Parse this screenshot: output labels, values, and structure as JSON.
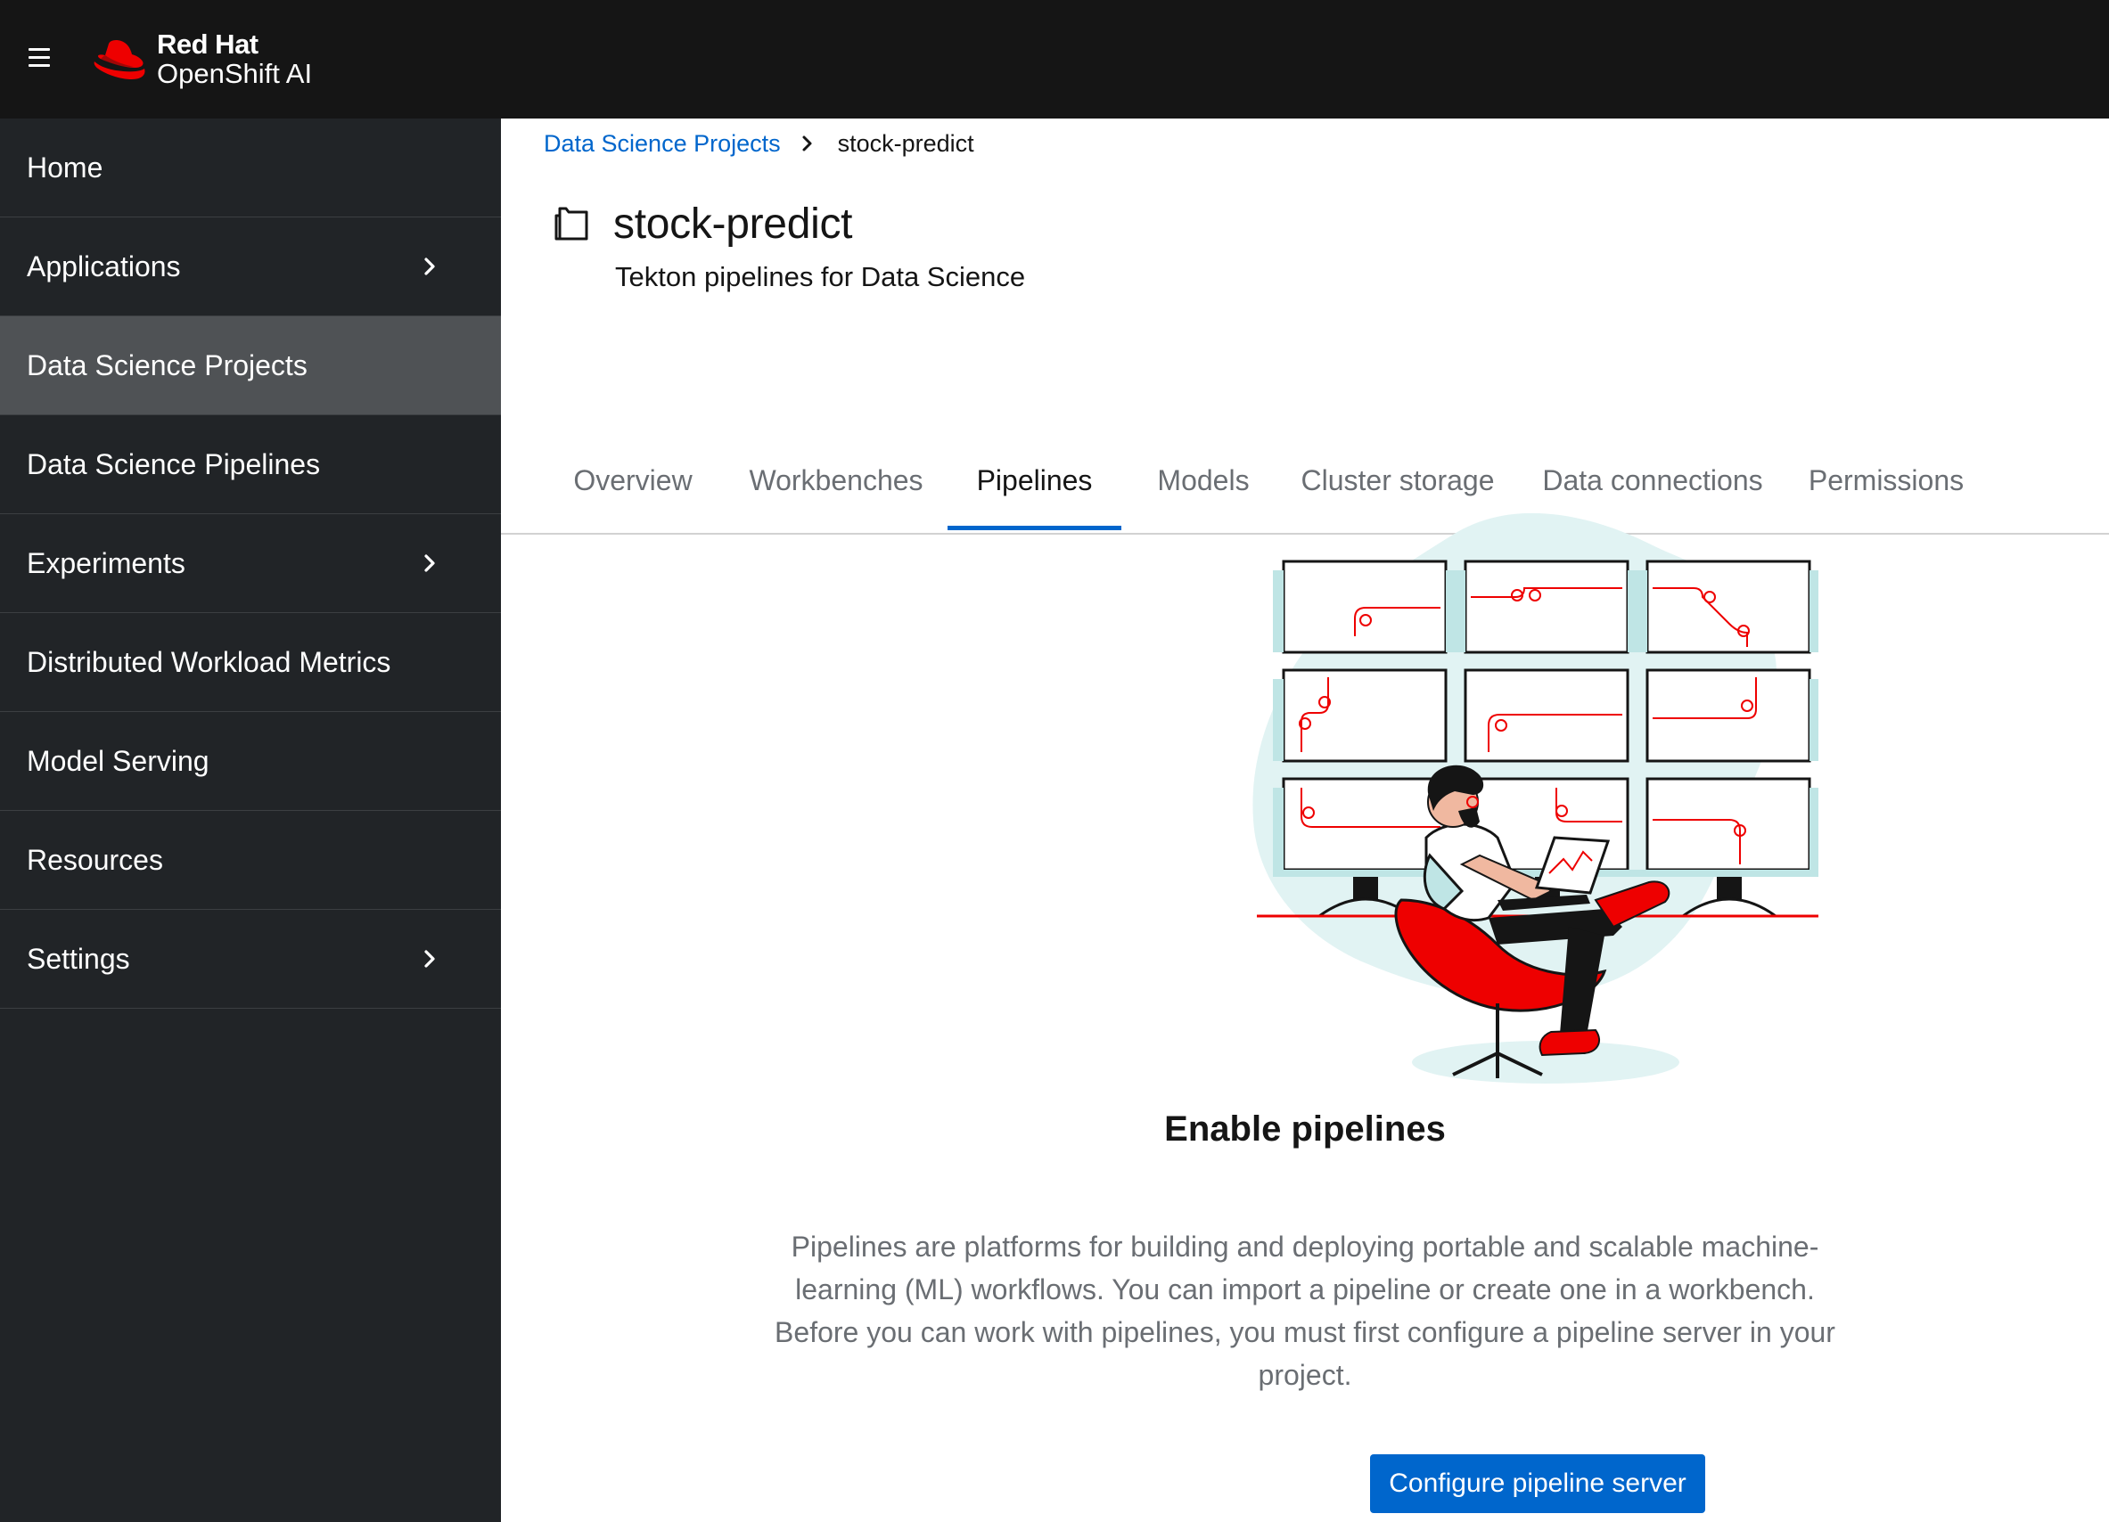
{
  "masthead": {
    "brand_line1": "Red Hat",
    "brand_line2": "OpenShift AI",
    "menu_icon": "hamburger-icon",
    "brand_color": "#ee0000"
  },
  "sidebar": {
    "items": [
      {
        "label": "Home",
        "has_submenu": false
      },
      {
        "label": "Applications",
        "has_submenu": true
      },
      {
        "label": "Data Science Projects",
        "has_submenu": false,
        "active": true
      },
      {
        "label": "Data Science Pipelines",
        "has_submenu": false
      },
      {
        "label": "Experiments",
        "has_submenu": true
      },
      {
        "label": "Distributed Workload Metrics",
        "has_submenu": false
      },
      {
        "label": "Model Serving",
        "has_submenu": false
      },
      {
        "label": "Resources",
        "has_submenu": false
      },
      {
        "label": "Settings",
        "has_submenu": true
      }
    ]
  },
  "breadcrumb": {
    "parent": "Data Science Projects",
    "current": "stock-predict"
  },
  "project": {
    "title": "stock-predict",
    "description": "Tekton pipelines for Data Science"
  },
  "tabs": [
    {
      "label": "Overview"
    },
    {
      "label": "Workbenches"
    },
    {
      "label": "Pipelines",
      "active": true
    },
    {
      "label": "Models"
    },
    {
      "label": "Cluster storage"
    },
    {
      "label": "Data connections"
    },
    {
      "label": "Permissions"
    }
  ],
  "empty_state": {
    "title": "Enable pipelines",
    "body": "Pipelines are platforms for building and deploying portable and scalable machine-learning (ML) workflows. You can import a pipeline or create one in a workbench. Before you can work with pipelines, you must first configure a pipeline server in your project.",
    "button_label": "Configure pipeline server"
  },
  "colors": {
    "masthead_bg": "#151515",
    "sidebar_bg": "#212427",
    "sidebar_active_bg": "#4f5255",
    "link_blue": "#0066cc",
    "illustration_red": "#ee0000",
    "illustration_teal": "#e1f3f3"
  }
}
